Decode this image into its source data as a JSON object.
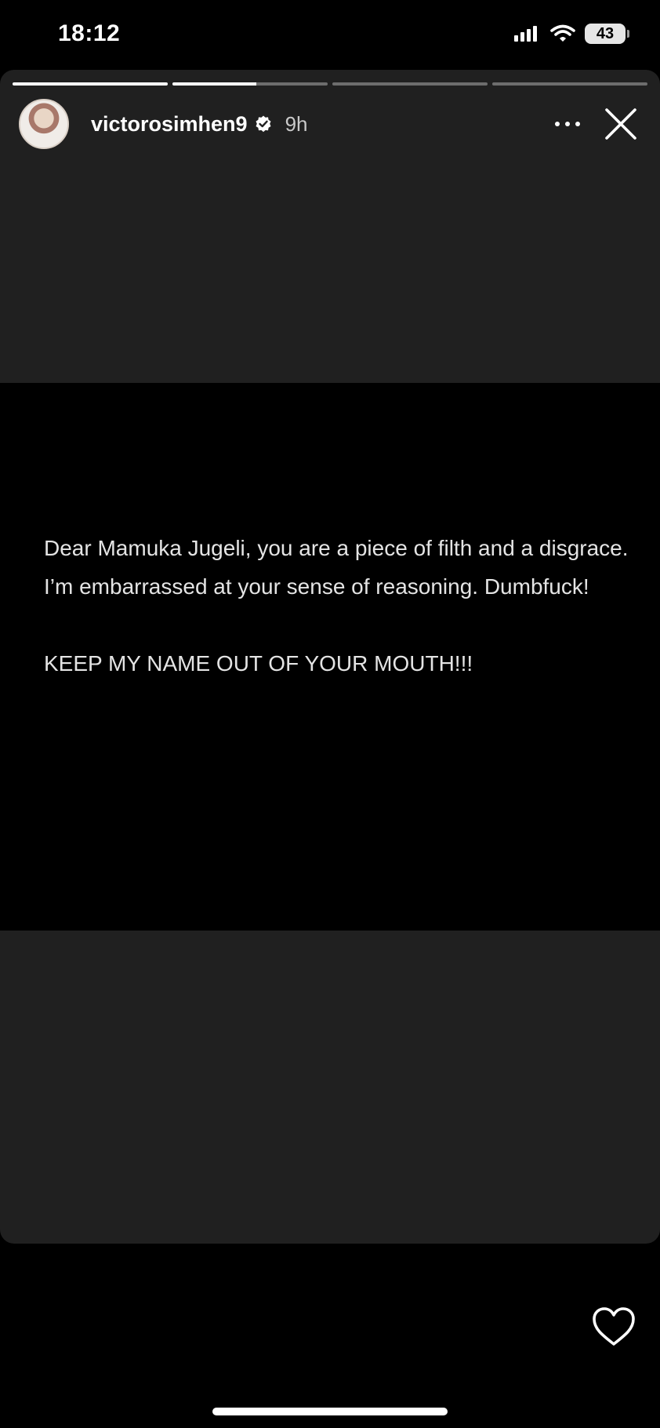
{
  "status_bar": {
    "time": "18:12",
    "battery": "43",
    "icons": [
      "cellular-signal-icon",
      "wifi-icon",
      "battery-icon"
    ]
  },
  "story": {
    "progress_segments": [
      1,
      0.54,
      0,
      0
    ],
    "user": {
      "username": "victorosimhen9",
      "verified": true,
      "time_ago": "9h"
    },
    "text": {
      "paragraph1": "Dear Mamuka Jugeli, you are a piece of filth and a disgrace. I’m embarrassed at your sense of reasoning. Dumbfuck!",
      "paragraph2": "KEEP MY NAME OUT OF YOUR MOUTH!!!"
    }
  },
  "actions": {
    "icons": [
      "more-options-icon",
      "close-icon",
      "heart-icon"
    ]
  },
  "colors": {
    "background": "#000000",
    "card_background": "#202020",
    "text": "#e4e4e4",
    "secondary_text": "#c9c9c9"
  }
}
